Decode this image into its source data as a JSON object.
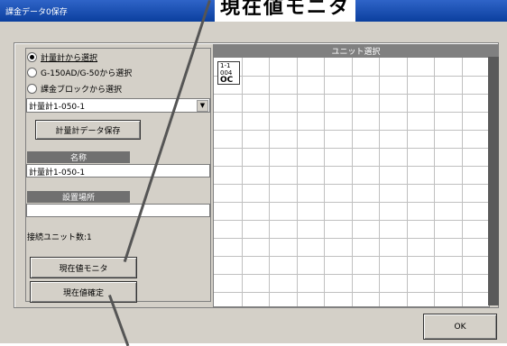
{
  "window": {
    "title": "課金データ0保存"
  },
  "heading": "現在値モニタ",
  "selection": {
    "options": [
      {
        "label": "計量計から選択",
        "selected": true
      },
      {
        "label": "G-150AD/G-50から選択",
        "selected": false
      },
      {
        "label": "課金ブロックから選択",
        "selected": false
      }
    ],
    "dropdown_value": "計量計1-050-1"
  },
  "buttons": {
    "meter_data_save": "計量計データ保存",
    "current_monitor": "現在値モニタ",
    "current_settle": "現在値確定",
    "ok": "OK"
  },
  "fields": {
    "name_label": "名称",
    "name_value": "計量計1-050-1",
    "location_label": "設置場所",
    "location_value": ""
  },
  "unit_count_text": "接続ユニット数:1",
  "unit_grid": {
    "header": "ユニット選択",
    "units": [
      {
        "line1": "1-1",
        "line2": "004",
        "line3": "OC"
      }
    ]
  }
}
